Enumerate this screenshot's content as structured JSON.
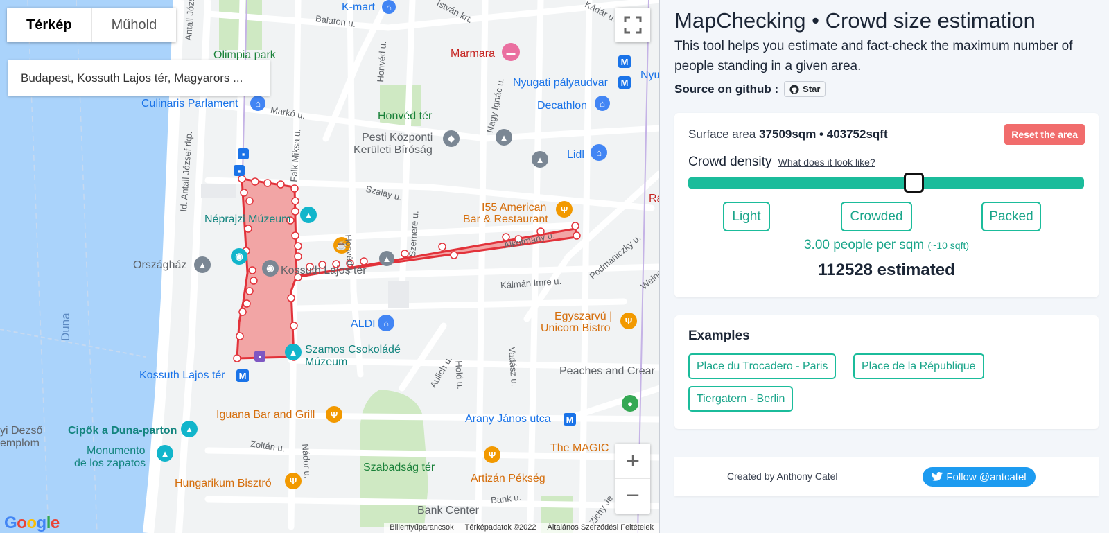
{
  "map": {
    "type_toggle": {
      "map_label": "Térkép",
      "satellite_label": "Műhold"
    },
    "search_value": "Budapest, Kossuth Lajos tér, Magyarors ...",
    "labels": {
      "kmart": "K-mart",
      "balaton": "Balaton u.",
      "istvan": "István krt.",
      "kadar": "Kádár u.",
      "olimpia": "Olimpia park",
      "marmara": "Marmara",
      "nyugati": "Nyugati pályaudvar",
      "nyu": "Nyu",
      "culinaris": "Culinaris Parlament",
      "marko": "Markó u.",
      "honved_ter": "Honvéd tér",
      "decathlon": "Decathlon",
      "pesti1": "Pesti Központi",
      "pesti2": "Kerületi Bíróság",
      "lidl": "Lidl",
      "antall1": "Antall József",
      "antall2": "Id. Antall József rkp.",
      "falk": "Falk Miksa u.",
      "honved_u": "Honvéd u.",
      "honved_u2": "Honvéd u.",
      "nagy_ignac": "Nagy Ignác u.",
      "szalay": "Szalay u.",
      "nepr": "Néprajzi Múzeum",
      "i55_1": "I55 American",
      "i55_2": "Bar & Restaurant",
      "ra": "Ra",
      "szemere": "Szemere u.",
      "alkotmany": "Alkotmány u.",
      "podmaniczky": "Podmaniczky u.",
      "weine": "Weine",
      "orszaghaz": "Országház",
      "kossuth_ter": "Kossuth Lajos tér",
      "kalman": "Kálmán Imre u.",
      "duna": "Duna",
      "aldi": "ALDI",
      "egyszarvu1": "Egyszarvú |",
      "egyszarvu2": "Unicorn Bistro",
      "szamos1": "Szamos Csokoládé",
      "szamos2": "Múzeum",
      "kossuth_metro": "Kossuth Lajos tér",
      "aulich": "Aulich u.",
      "hold": "Hold u.",
      "vadasz": "Vadász u.",
      "peaches": "Peaches and Crear",
      "iguana": "Iguana Bar and Grill",
      "arany": "Arany János utca",
      "jozsef1": "yi Dezső",
      "jozsef2": "emplom",
      "cipok": "Cipők a Duna-parton",
      "monumento1": "Monumento",
      "monumento2": "de los zapatos",
      "zoltan": "Zoltán u.",
      "nador": "Nádor u.",
      "magic": "The MAGIC",
      "szabadsag": "Szabadság tér",
      "hungarikum": "Hungarikum Bisztró",
      "artizan": "Artizán Pékség",
      "bank_u": "Bank u.",
      "bank_center": "Bank Center",
      "zichy": "Zichy Je"
    },
    "google": "Google",
    "footer": {
      "shortcuts": "Billentyűparancsok",
      "mapdata": "Térképadatok ©2022",
      "terms": "Általános Szerződési Feltételek"
    },
    "zoom_in": "+",
    "zoom_out": "−"
  },
  "panel": {
    "title": "MapChecking • Crowd size estimation",
    "description": "This tool helps you estimate and fact-check the maximum number of people standing in a given area.",
    "source_label": "Source on github :",
    "github_star": "Star",
    "surface_prefix": "Surface area",
    "surface_sqm": "37509sqm",
    "surface_sep": "•",
    "surface_sqft": "403752sqft",
    "reset_label": "Reset the area",
    "density_label": "Crowd density",
    "density_link": "What does it look like?",
    "density_slider_fraction": 0.57,
    "density_buttons": [
      "Light",
      "Crowded",
      "Packed"
    ],
    "people_per_sqm": "3.00 people per sqm",
    "sqft_hint": "(~10 sqft)",
    "estimated": "112528 estimated",
    "examples_title": "Examples",
    "examples": [
      "Place du Trocadero - Paris",
      "Place de la République",
      "Tiergatern - Berlin"
    ],
    "credit": "Created by Anthony Catel",
    "twitter_follow": "Follow @antcatel"
  },
  "colors": {
    "accent": "#1bbc9b",
    "reset": "#f16c6c",
    "polygon_fill": "#f28b8b",
    "polygon_stroke": "#e2323a",
    "water": "#aad3fb",
    "park": "#cfe9c3"
  }
}
